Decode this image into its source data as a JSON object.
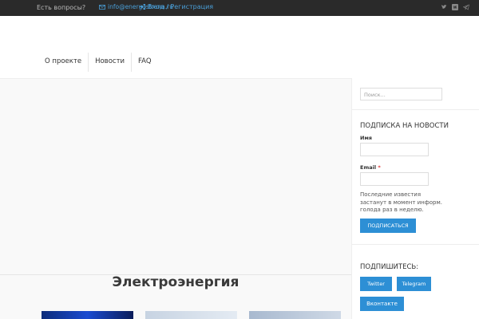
{
  "topbar": {
    "question": "Есть вопросы?",
    "email": "info@energostrana.ru",
    "email_icon": "mail-icon",
    "login": "Вход / Регистрация",
    "login_icon": "sign-in-icon",
    "social_icons": [
      "twitter-icon",
      "vk-icon",
      "telegram-icon"
    ]
  },
  "nav": {
    "items": [
      "О проекте",
      "Новости",
      "FAQ"
    ]
  },
  "main": {
    "heading": "Электроэнергия"
  },
  "sidebar": {
    "search_placeholder": "Поиск...",
    "subscribe_title": "ПОДПИСКА НА НОВОСТИ",
    "name_label": "Имя",
    "email_label": "Email",
    "required_mark": "*",
    "note": "Последние известия застанут в момент информ. голода раз в неделю.",
    "subscribe_button": "ПОДПИСАТЬСЯ",
    "follow_title": "ПОДПИШИТЕСЬ:",
    "twitter_button": "Twitter",
    "telegram_button": "Telegram",
    "vk_button": "Вконтакте"
  },
  "colors": {
    "topbar_bg": "#2a2a2a",
    "link": "#4a9fd8",
    "button": "#2d8fd5"
  }
}
